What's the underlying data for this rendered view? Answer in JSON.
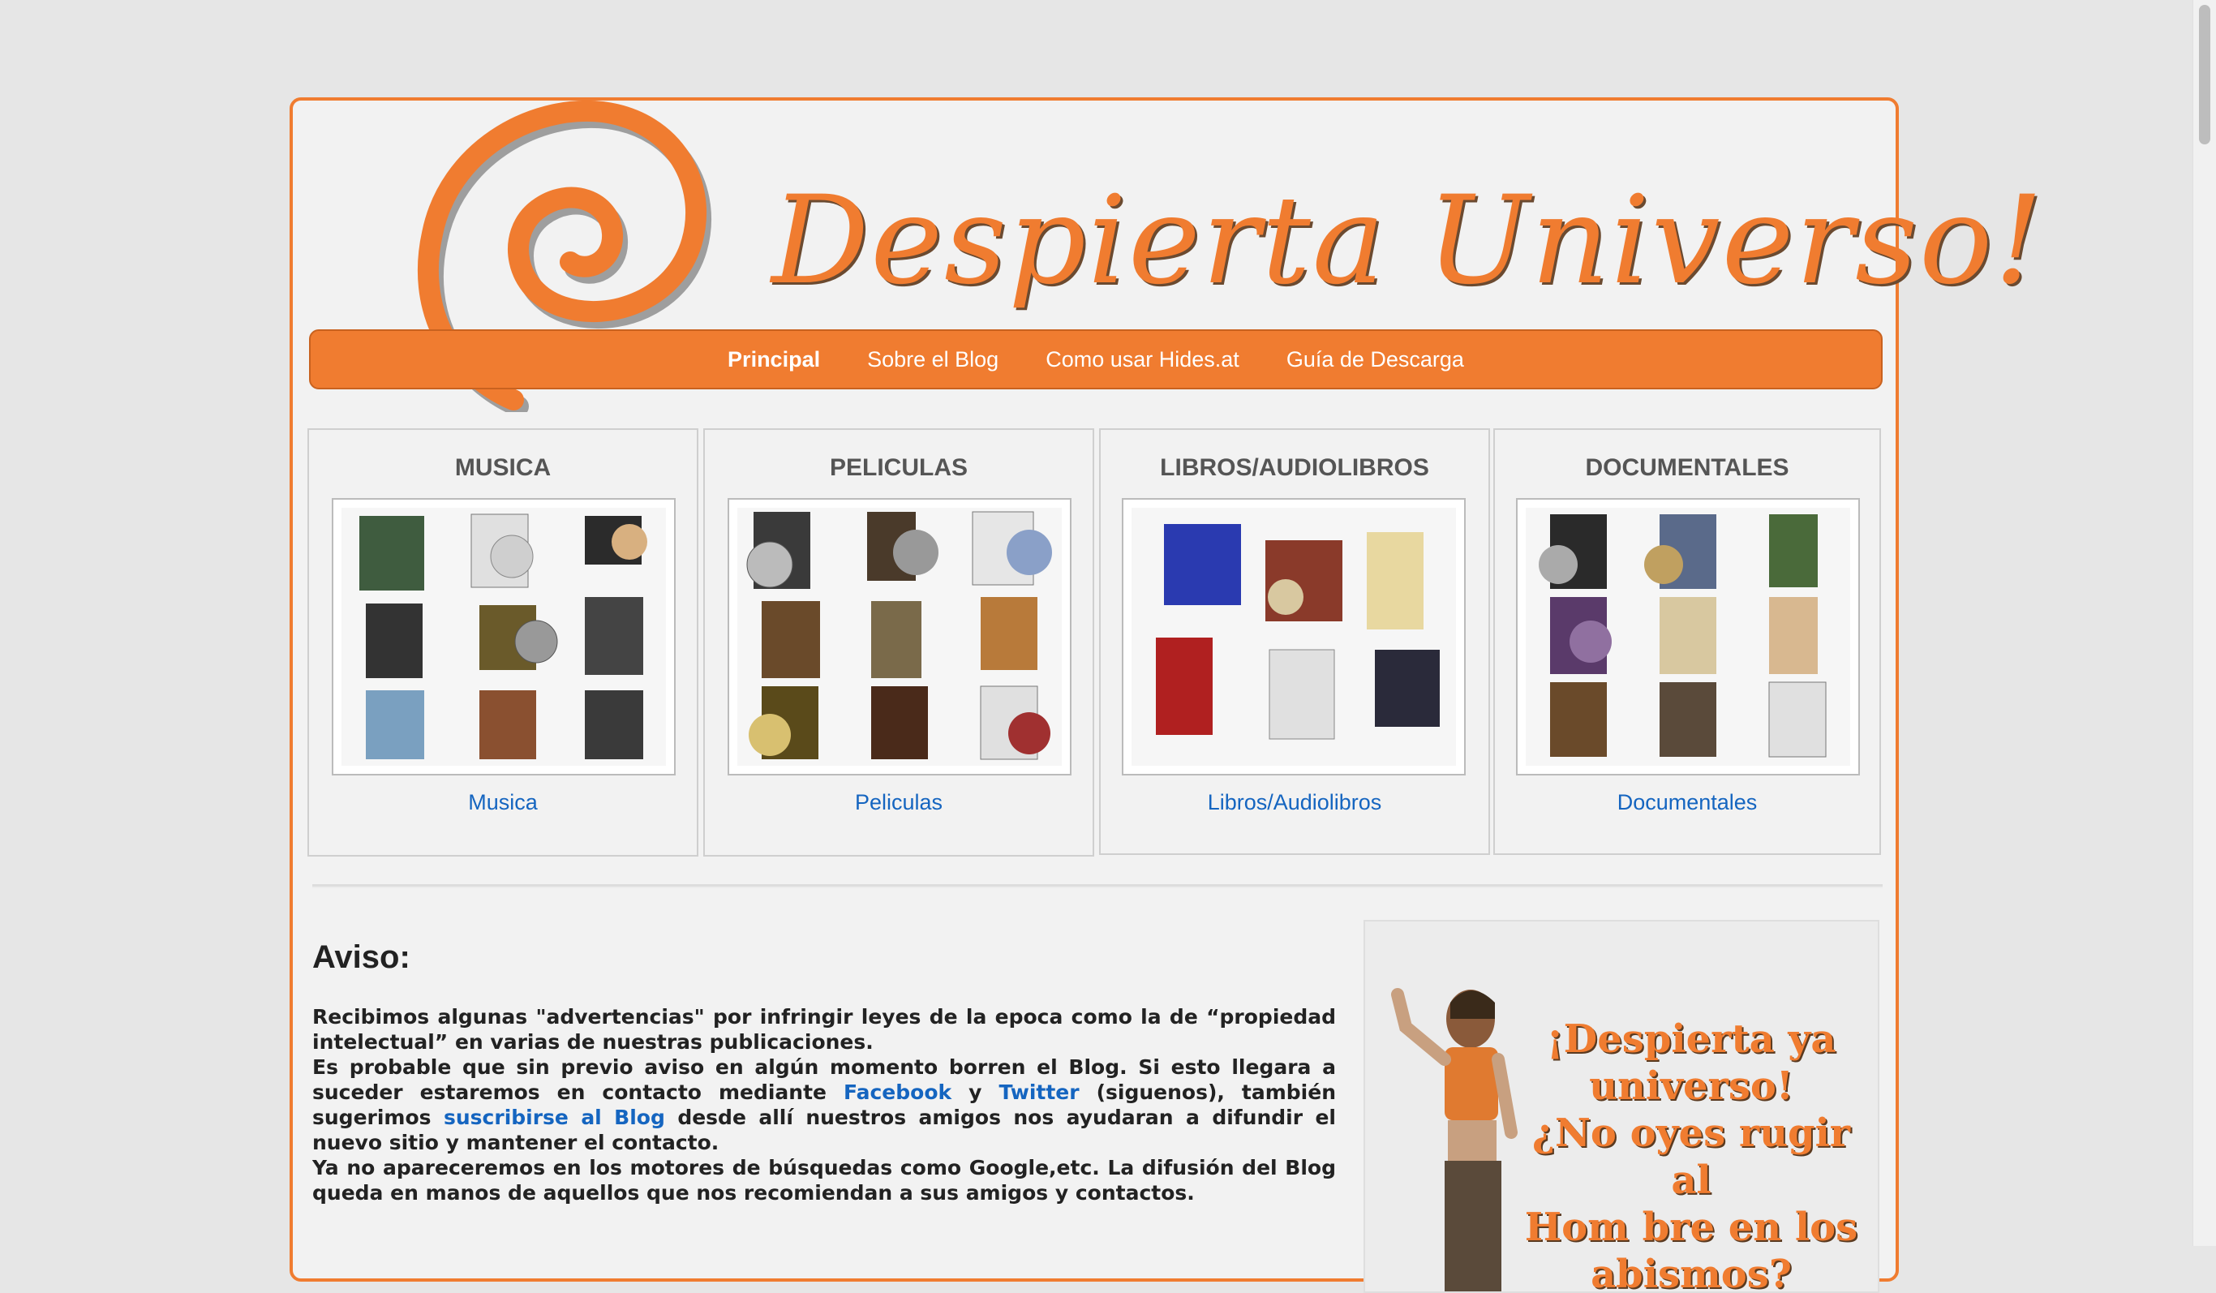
{
  "header": {
    "title": "Despierta Universo!"
  },
  "nav": {
    "items": [
      {
        "label": "Principal"
      },
      {
        "label": "Sobre el Blog"
      },
      {
        "label": "Como usar Hides.at"
      },
      {
        "label": "Guía de Descarga"
      }
    ]
  },
  "categories": [
    {
      "title": "MUSICA",
      "link": "Musica"
    },
    {
      "title": "PELICULAS",
      "link": "Peliculas"
    },
    {
      "title": "LIBROS/AUDIOLIBROS",
      "link": "Libros/Audiolibros"
    },
    {
      "title": "DOCUMENTALES",
      "link": "Documentales"
    }
  ],
  "notice": {
    "title": "Aviso:",
    "p1": "Recibimos algunas \"advertencias\" por infringir leyes de la epoca como la de “propiedad intelectual” en varias de nuestras publicaciones.",
    "p2_a": "Es probable que sin previo aviso en algún momento borren el Blog. Si esto llegara a suceder estaremos en contacto mediante",
    "p2_facebook": "Facebook",
    "p2_y": "y",
    "p2_twitter": "Twitter",
    "p2_b": "(siguenos), también sugerimos",
    "p2_subscribe": "suscribirse al Blog",
    "p2_c": "desde allí nuestros amigos nos ayudaran a difundir el nuevo sitio y mantener el contacto.",
    "p3": "Ya no apareceremos en los motores de búsquedas como Google,etc. La difusión del Blog queda en manos de aquellos que nos recomiendan a sus amigos y contactos."
  },
  "side_banner": {
    "line1": "¡Despierta ya",
    "line2": "universo!",
    "line3": "¿No oyes rugir al",
    "line4": "Hom bre en los",
    "line5": "abismos?"
  },
  "colors": {
    "accent": "#f07c30",
    "link": "#1565c0",
    "background": "#e6e6e6"
  }
}
